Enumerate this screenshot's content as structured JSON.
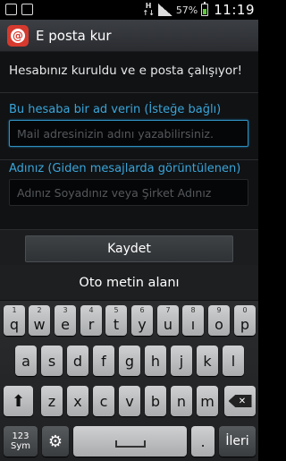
{
  "status_bar": {
    "network_top": "H",
    "network_bottom": "↑↓",
    "battery": "57%",
    "time": "11:19"
  },
  "action_bar": {
    "app_icon": "email-at-icon",
    "app_icon_glyph": "@",
    "title": "E posta kur"
  },
  "content": {
    "message": "Hesabınız kuruldu ve e posta çalışıyor!",
    "account_name_label": "Bu hesaba bir ad verin (İsteğe bağlı)",
    "account_name_placeholder": "Mail adresinizin adını yazabilirsiniz.",
    "your_name_label": "Adınız (Giden mesajlarda görüntülenen)",
    "your_name_placeholder": "Adınız Soyadınız veya Şirket Adınız",
    "save_button": "Kaydet"
  },
  "keyboard": {
    "suggestion": "Oto metin alanı",
    "row1": [
      {
        "num": "1",
        "key": "q"
      },
      {
        "num": "2",
        "key": "w"
      },
      {
        "num": "3",
        "key": "e"
      },
      {
        "num": "4",
        "key": "r"
      },
      {
        "num": "5",
        "key": "t"
      },
      {
        "num": "6",
        "key": "y"
      },
      {
        "num": "7",
        "key": "u"
      },
      {
        "num": "8",
        "key": "ı"
      },
      {
        "num": "9",
        "key": "o"
      },
      {
        "num": "0",
        "key": "p"
      }
    ],
    "row2": [
      "a",
      "s",
      "d",
      "f",
      "g",
      "h",
      "j",
      "k",
      "l"
    ],
    "row3": [
      "z",
      "x",
      "c",
      "v",
      "b",
      "n",
      "m"
    ],
    "shift_icon": "shift-arrow-icon",
    "backspace_icon": "backspace-icon",
    "sym_top": "123",
    "sym_bottom": "Sym",
    "settings_icon": "gear-icon",
    "space_icon": "space-icon",
    "period": ".",
    "next": "İleri"
  }
}
